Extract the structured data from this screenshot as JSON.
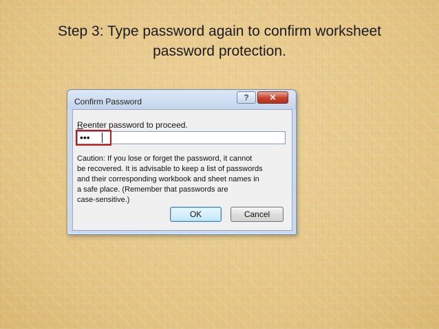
{
  "slide": {
    "title_line1": "Step 3: Type password again to confirm worksheet",
    "title_line2": "password protection."
  },
  "dialog": {
    "title": "Confirm Password",
    "help_glyph": "?",
    "close_glyph": "✕",
    "prompt_first_letter": "R",
    "prompt_rest": "eenter password to proceed.",
    "password_mask": "•••",
    "caution_lines": [
      "Caution: If you lose or forget the password, it cannot",
      "be recovered. It is advisable to keep a list of passwords",
      "and their corresponding workbook and sheet names in",
      "a safe place.  (Remember that passwords are",
      "case-sensitive.)"
    ],
    "ok_label": "OK",
    "cancel_label": "Cancel"
  },
  "colors": {
    "highlight": "#c0151a",
    "background": "#e8cc8c"
  }
}
